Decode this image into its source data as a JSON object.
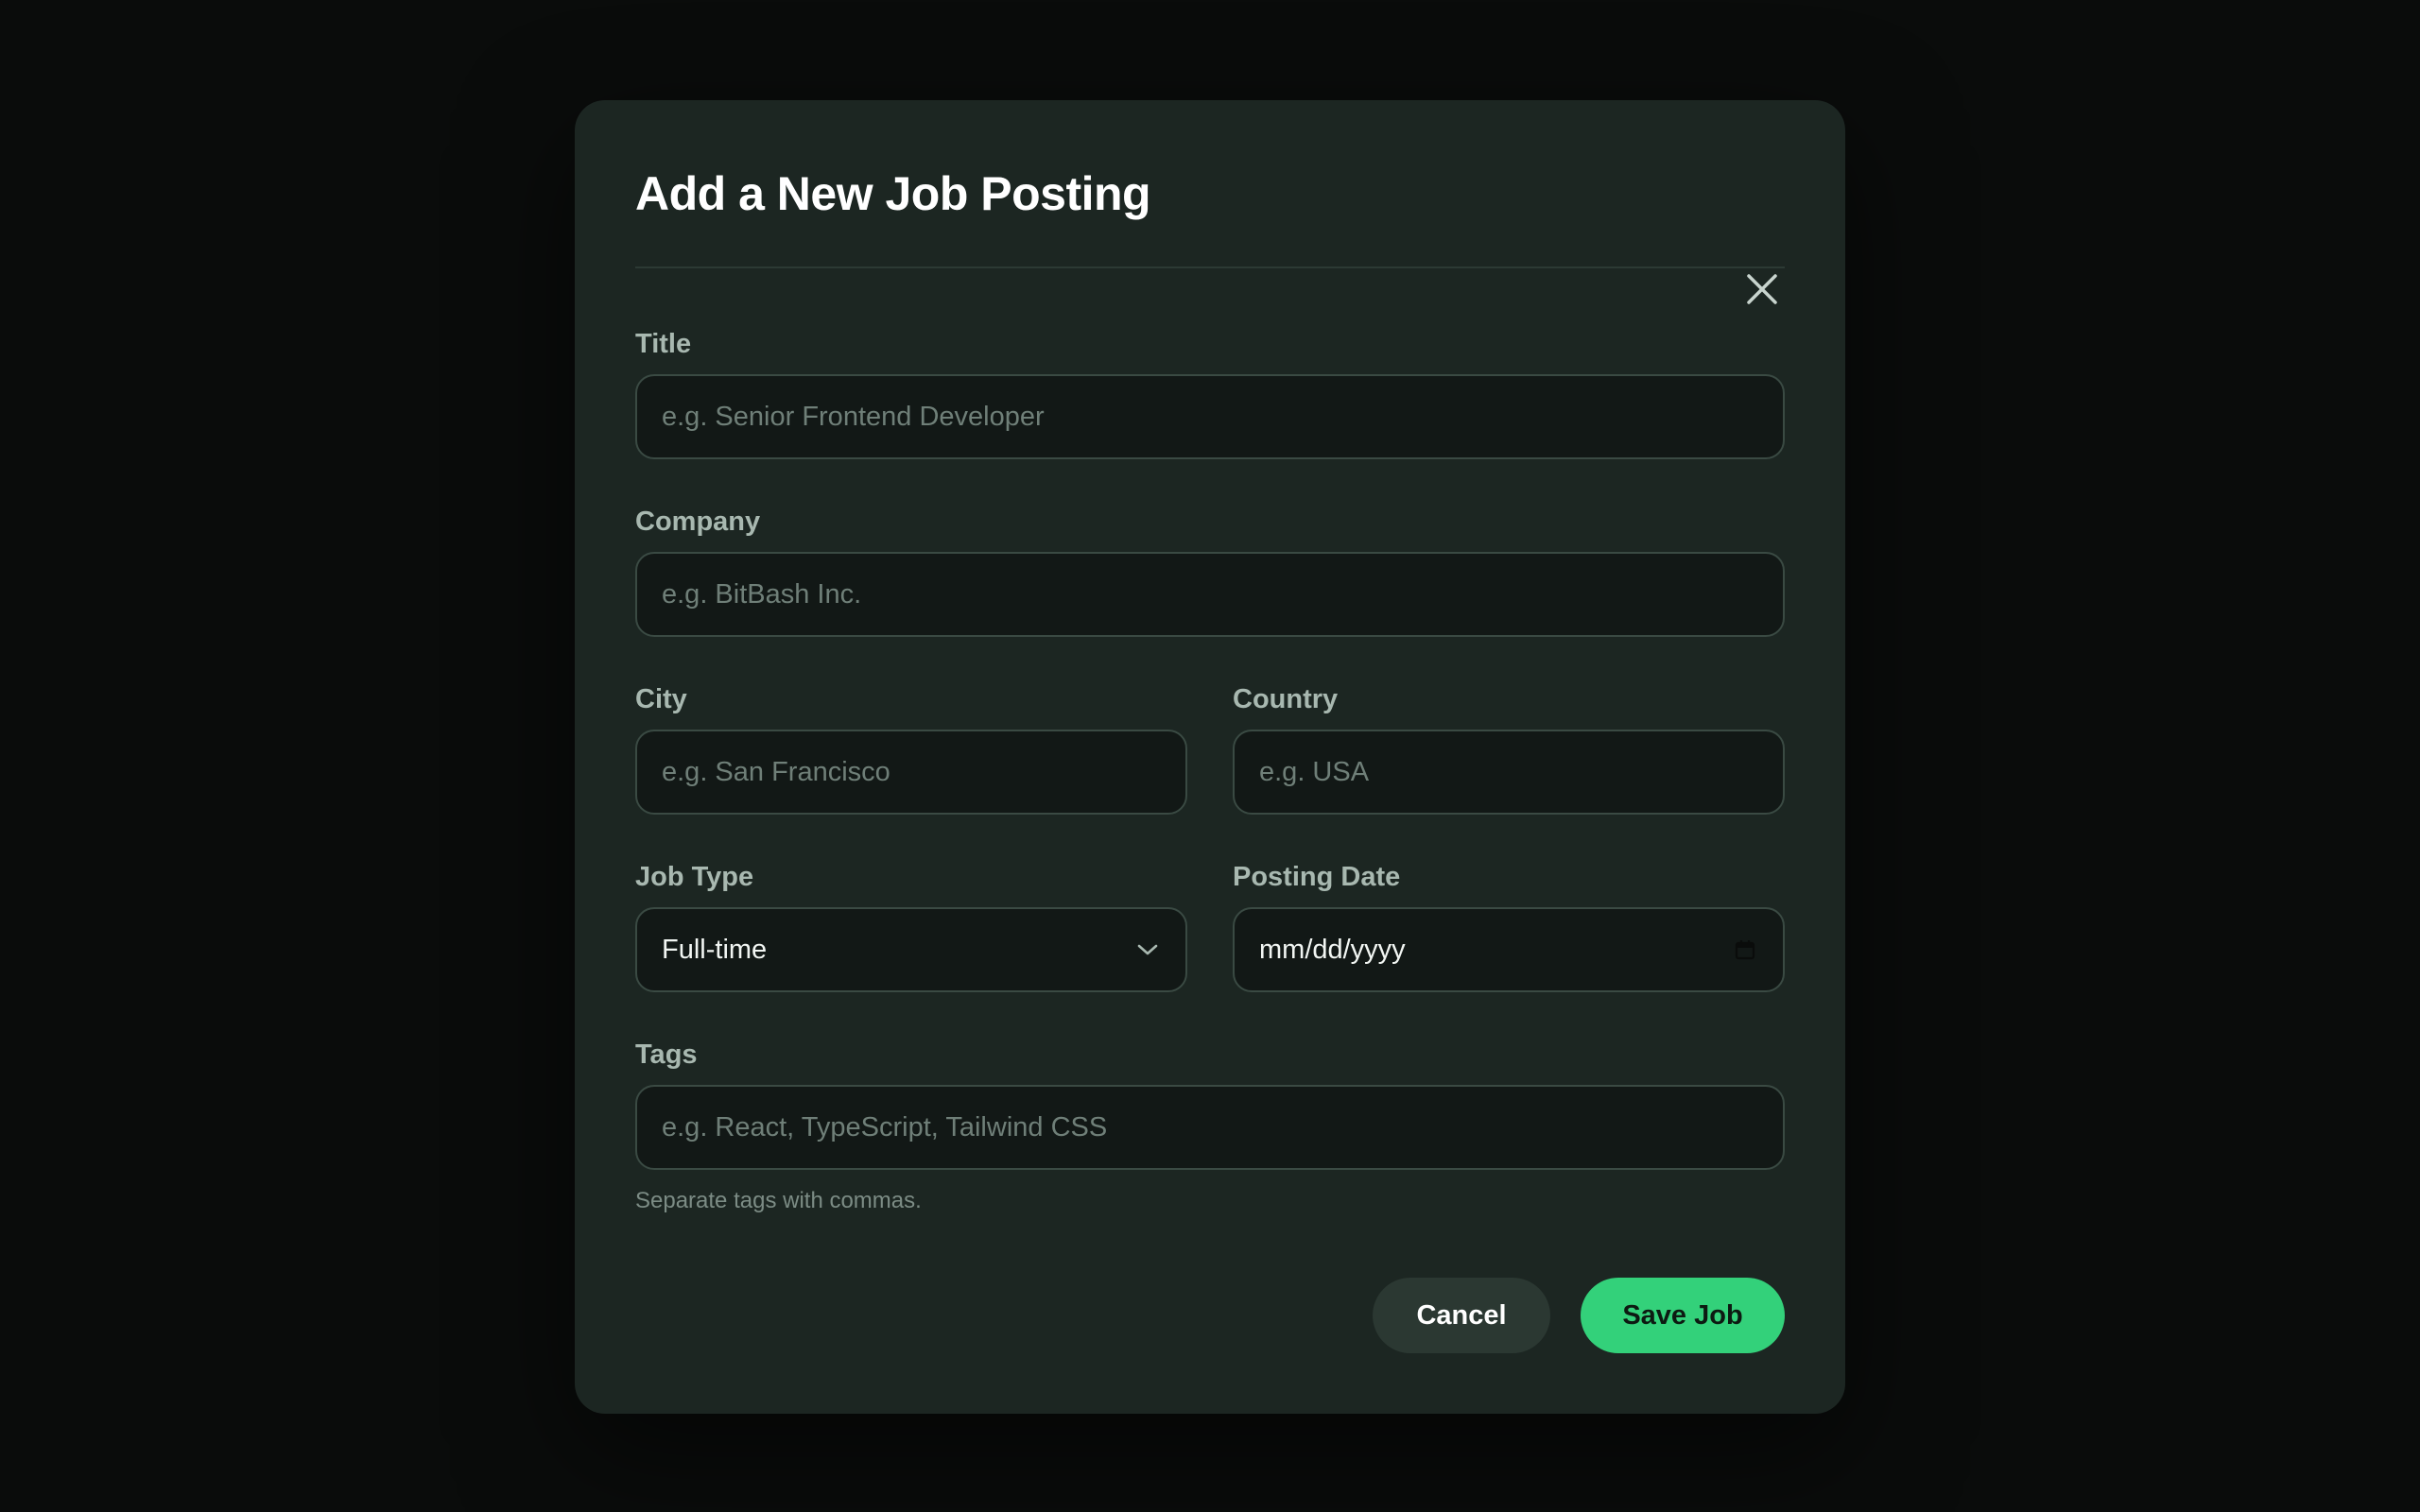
{
  "modal": {
    "title": "Add a New Job Posting"
  },
  "form": {
    "title": {
      "label": "Title",
      "placeholder": "e.g. Senior Frontend Developer"
    },
    "company": {
      "label": "Company",
      "placeholder": "e.g. BitBash Inc."
    },
    "city": {
      "label": "City",
      "placeholder": "e.g. San Francisco"
    },
    "country": {
      "label": "Country",
      "placeholder": "e.g. USA"
    },
    "job_type": {
      "label": "Job Type",
      "selected": "Full-time"
    },
    "posting_date": {
      "label": "Posting Date",
      "value": "mm/dd/yyyy"
    },
    "tags": {
      "label": "Tags",
      "placeholder": "e.g. React, TypeScript, Tailwind CSS",
      "hint": "Separate tags with commas."
    }
  },
  "actions": {
    "cancel_label": "Cancel",
    "save_label": "Save Job"
  },
  "colors": {
    "accent": "#33d17a",
    "modal_bg": "#1c2622",
    "page_bg": "#0a0c0b",
    "input_bg": "#121816"
  },
  "icons": {
    "close": "close-icon",
    "dropdown": "chevron-down-icon",
    "calendar": "calendar-icon"
  }
}
